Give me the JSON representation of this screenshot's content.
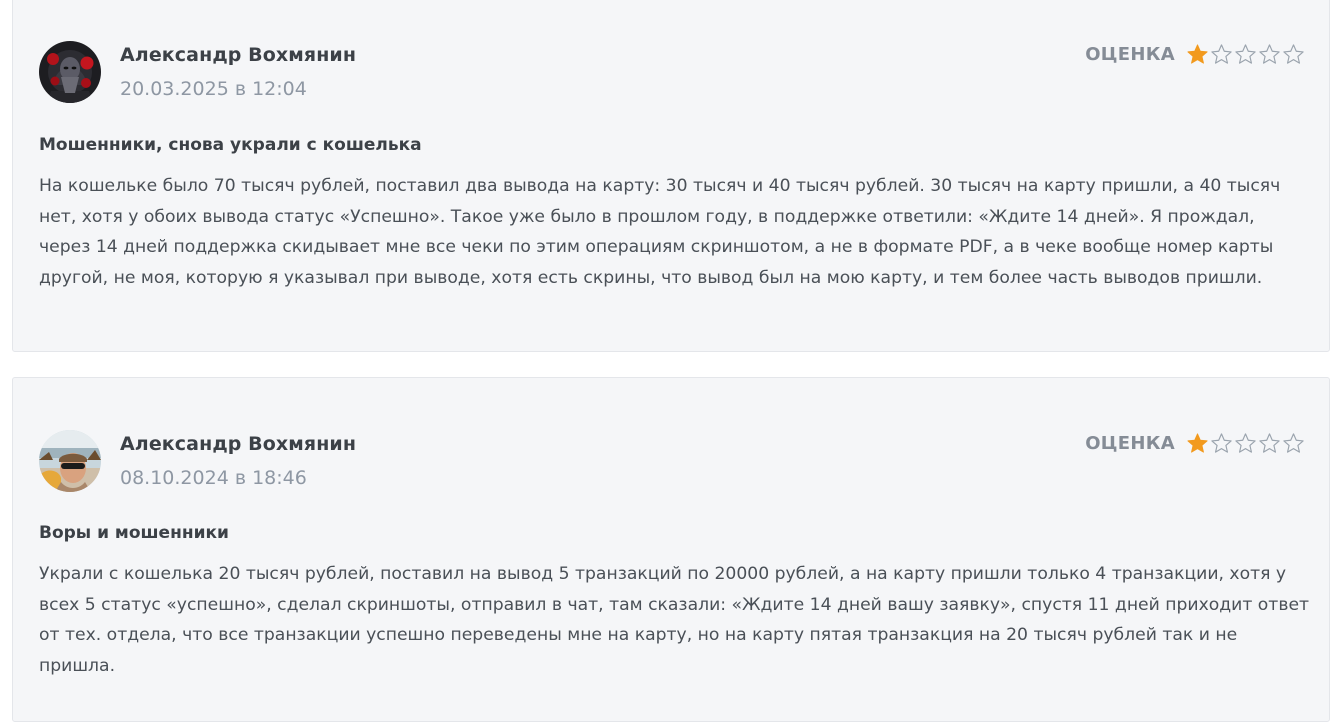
{
  "reviews": [
    {
      "author": "Александр Вохмянин",
      "date": "20.03.2025 в 12:04",
      "rating_label": "ОЦЕНКА",
      "rating": 1,
      "rating_max": 5,
      "title": "Мошенники, снова украли с кошелька",
      "text": "На кошельке было 70 тысяч рублей, поставил два вывода на карту: 30 тысяч и 40 тысяч рублей. 30 тысяч на карту пришли, а 40 тысяч нет, хотя у обоих вывода статус «Успешно». Такое уже было в прошлом году, в поддержке ответили: «Ждите 14 дней». Я прождал, через 14 дней поддержка скидывает мне все чеки по этим операциям скриншотом, а не в формате PDF, а в чеке вообще номер карты другой, не моя, которую я указывал при выводе, хотя есть скрины, что вывод был на мою карту, и тем более часть выводов пришли."
    },
    {
      "author": "Александр Вохмянин",
      "date": "08.10.2024 в 18:46",
      "rating_label": "ОЦЕНКА",
      "rating": 1,
      "rating_max": 5,
      "title": "Воры и мошенники",
      "text": "Украли с кошелька 20 тысяч рублей, поставил на вывод 5 транзакций по 20000 рублей, а на карту пришли только 4 транзакции, хотя у всех 5 статус «успешно», сделал скриншоты, отправил в чат, там сказали: «Ждите 14 дней вашу заявку», спустя 11 дней приходит ответ от тех. отдела, что все транзакции успешно переведены мне на карту, но на карту пятая транзакция на 20 тысяч рублей так и не пришла."
    }
  ],
  "colors": {
    "star_filled": "#f29a1e",
    "star_empty": "#9aa3ad",
    "card_background": "#f5f6f8"
  }
}
